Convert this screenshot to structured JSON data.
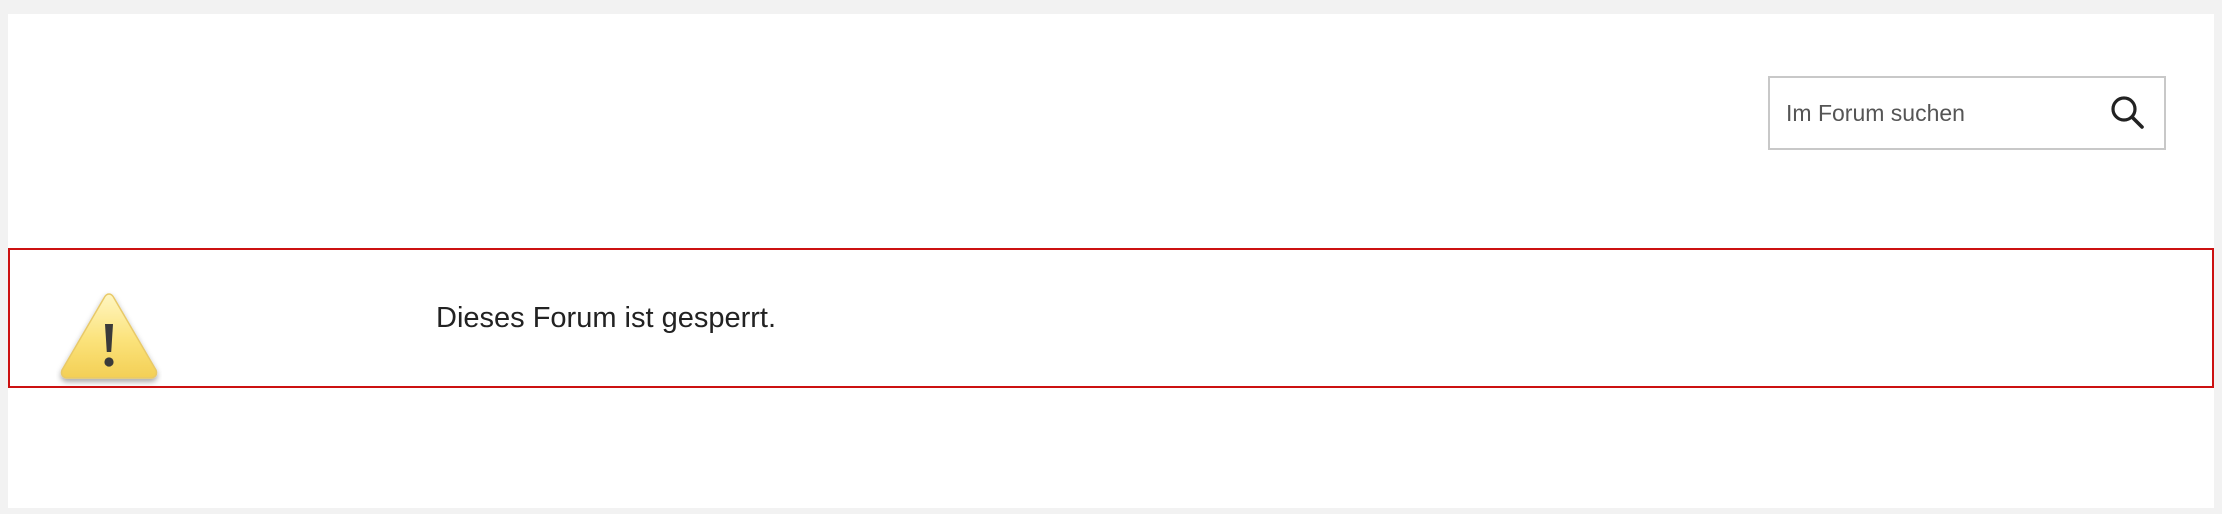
{
  "search": {
    "placeholder": "Im Forum suchen",
    "icon": "search-icon"
  },
  "notice": {
    "message": "Dieses Forum ist gesperrt.",
    "icon": "warning-icon",
    "border_color": "#cc1111"
  }
}
